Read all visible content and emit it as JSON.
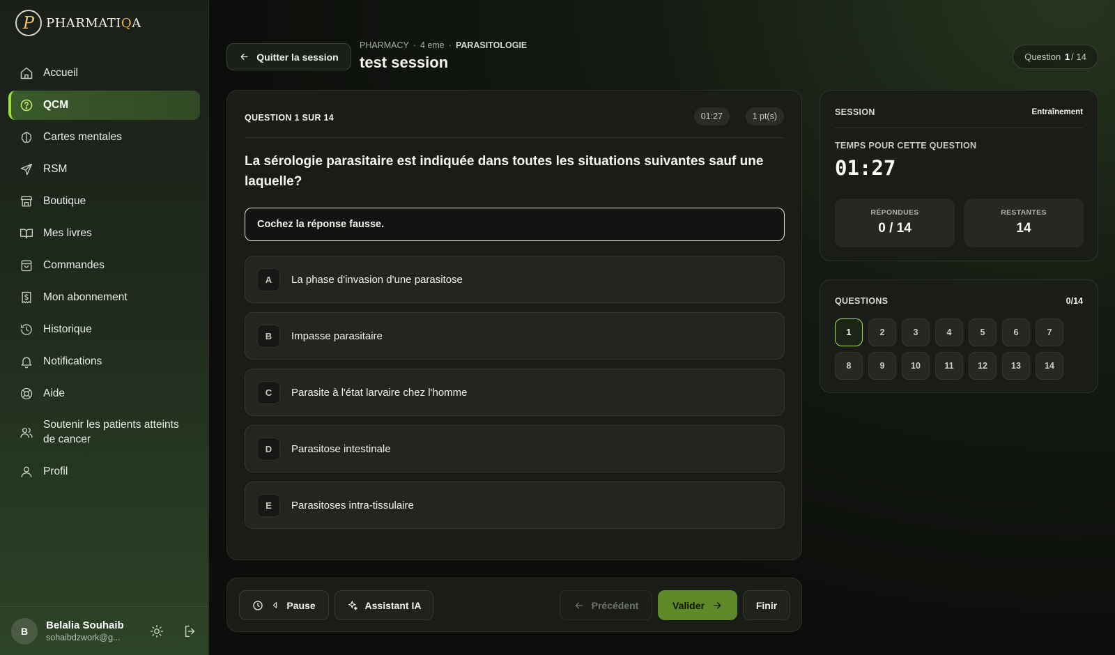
{
  "brand": {
    "name_prefix": "PHARMATI",
    "name_accent": "Q",
    "name_suffix": "A",
    "monogram": "P"
  },
  "sidebar": {
    "items": [
      {
        "label": "Accueil",
        "icon": "home-icon",
        "active": false
      },
      {
        "label": "QCM",
        "icon": "help-circle-icon",
        "active": true
      },
      {
        "label": "Cartes mentales",
        "icon": "brain-icon",
        "active": false
      },
      {
        "label": "RSM",
        "icon": "send-icon",
        "active": false
      },
      {
        "label": "Boutique",
        "icon": "store-icon",
        "active": false
      },
      {
        "label": "Mes livres",
        "icon": "book-open-icon",
        "active": false
      },
      {
        "label": "Commandes",
        "icon": "shopping-bag-icon",
        "active": false
      },
      {
        "label": "Mon abonnement",
        "icon": "dollar-receipt-icon",
        "active": false
      },
      {
        "label": "Historique",
        "icon": "history-icon",
        "active": false
      },
      {
        "label": "Notifications",
        "icon": "bell-icon",
        "active": false
      },
      {
        "label": "Aide",
        "icon": "lifebuoy-icon",
        "active": false
      },
      {
        "label": "Soutenir les patients atteints de cancer",
        "icon": "users-icon",
        "active": false
      },
      {
        "label": "Profil",
        "icon": "user-icon",
        "active": false
      }
    ]
  },
  "user": {
    "initial": "B",
    "name": "Belalia Souhaib",
    "email": "sohaibdzwork@g..."
  },
  "header": {
    "quit_label": "Quitter la session",
    "crumb_1": "PHARMACY",
    "crumb_2": "4 eme",
    "crumb_3": "PARASITOLOGIE",
    "title": "test session",
    "counter_prefix": "Question",
    "counter_current": "1",
    "counter_suffix": "/ 14"
  },
  "question": {
    "label": "QUESTION 1 SUR 14",
    "timer": "01:27",
    "points": "1 pt(s)",
    "text": "La sérologie parasitaire est indiquée dans toutes les situations suivantes sauf une laquelle?",
    "instruction": "Cochez la réponse fausse.",
    "options": [
      {
        "letter": "A",
        "text": "La phase d'invasion d'une parasitose"
      },
      {
        "letter": "B",
        "text": "Impasse parasitaire"
      },
      {
        "letter": "C",
        "text": "Parasite à l'état larvaire chez l'homme"
      },
      {
        "letter": "D",
        "text": "Parasitose intestinale"
      },
      {
        "letter": "E",
        "text": "Parasitoses intra-tissulaire"
      }
    ]
  },
  "actions": {
    "pause": "Pause",
    "assistant": "Assistant IA",
    "previous": "Précédent",
    "validate": "Valider",
    "finish": "Finir"
  },
  "session_panel": {
    "title": "SESSION",
    "mode": "Entraînement",
    "time_label": "TEMPS POUR CETTE QUESTION",
    "time_value": "01:27",
    "answered_label": "RÉPONDUES",
    "answered_value": "0 / 14",
    "remaining_label": "RESTANTES",
    "remaining_value": "14"
  },
  "questions_panel": {
    "title": "QUESTIONS",
    "count": "0/14",
    "numbers": [
      "1",
      "2",
      "3",
      "4",
      "5",
      "6",
      "7",
      "8",
      "9",
      "10",
      "11",
      "12",
      "13",
      "14"
    ],
    "current": "1"
  },
  "colors": {
    "accent": "#9be03f",
    "primary_button": "#5f8a2a"
  }
}
